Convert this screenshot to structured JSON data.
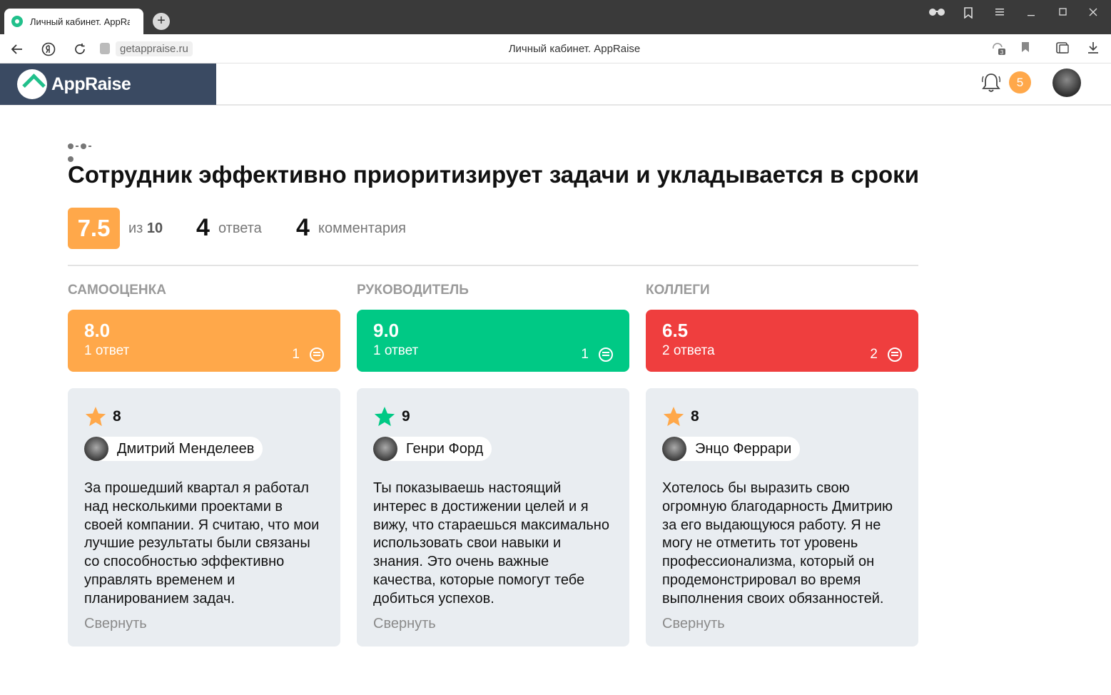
{
  "browser": {
    "tab_title": "Личный кабинет. AppRaise",
    "new_tab": "+",
    "url": "getappraise.ru",
    "page_title": "Личный кабинет. AppRaise",
    "extension_badge": "3"
  },
  "header": {
    "logo_text": "AppRaise",
    "notifications_count": "5"
  },
  "question": {
    "title": "Сотрудник эффективно приоритизирует задачи и укладывается в сроки",
    "score": "7.5",
    "of_label": "из",
    "of_max": "10",
    "answers_count": "4",
    "answers_label": "ответа",
    "comments_count": "4",
    "comments_label": "комментария"
  },
  "columns": [
    {
      "heading": "САМООЦЕНКА",
      "score": "8.0",
      "answers": "1 ответ",
      "comments": "1",
      "color": "#ffa84a",
      "review": {
        "rating": "8",
        "star_color": "#ffa84a",
        "author": "Дмитрий Менделеев",
        "text": "За прошедший квартал я работал над несколькими проектами в своей компании. Я считаю, что мои лучшие результаты были связаны со способностью эффективно управлять временем и планированием задач.",
        "collapse": "Свернуть"
      }
    },
    {
      "heading": "РУКОВОДИТЕЛЬ",
      "score": "9.0",
      "answers": "1 ответ",
      "comments": "1",
      "color": "#00c985",
      "review": {
        "rating": "9",
        "star_color": "#00c985",
        "author": "Генри Форд",
        "text": "Ты показываешь настоящий интерес в достижении целей и я вижу, что стараешься максимально использовать свои навыки и знания. Это очень важные качества, которые помогут тебе добиться успехов.",
        "collapse": "Свернуть"
      }
    },
    {
      "heading": "КОЛЛЕГИ",
      "score": "6.5",
      "answers": "2 ответа",
      "comments": "2",
      "color": "#ef3e3e",
      "review": {
        "rating": "8",
        "star_color": "#ffa84a",
        "author": "Энцо Феррари",
        "text": "Хотелось бы выразить свою огромную благодарность Дмитрию за его выдающуюся работу. Я не могу не отметить тот уровень профессионализма, который он продемонстрировал во время выполнения своих обязанностей.",
        "collapse": "Свернуть"
      }
    }
  ]
}
